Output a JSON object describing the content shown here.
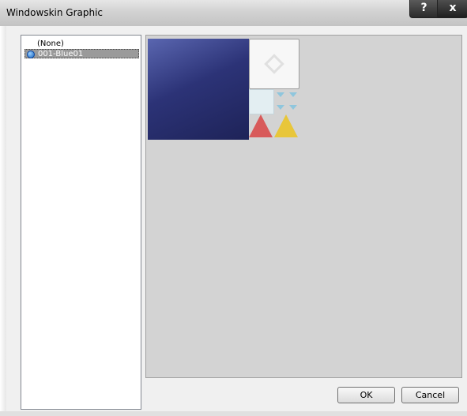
{
  "window": {
    "title": "Windowskin Graphic"
  },
  "titlebar": {
    "help_label": "?",
    "close_label": "x"
  },
  "list": {
    "items": [
      {
        "label": "(None)"
      },
      {
        "label": "001-Blue01",
        "selected": true
      }
    ]
  },
  "buttons": {
    "ok_label": "OK",
    "cancel_label": "Cancel"
  },
  "colors": {
    "window_bg": "#f0f0f0",
    "preview_bg": "#d3d3d3",
    "selection_bg": "#9a9a9a",
    "swatch_blue": "#2c3377"
  }
}
